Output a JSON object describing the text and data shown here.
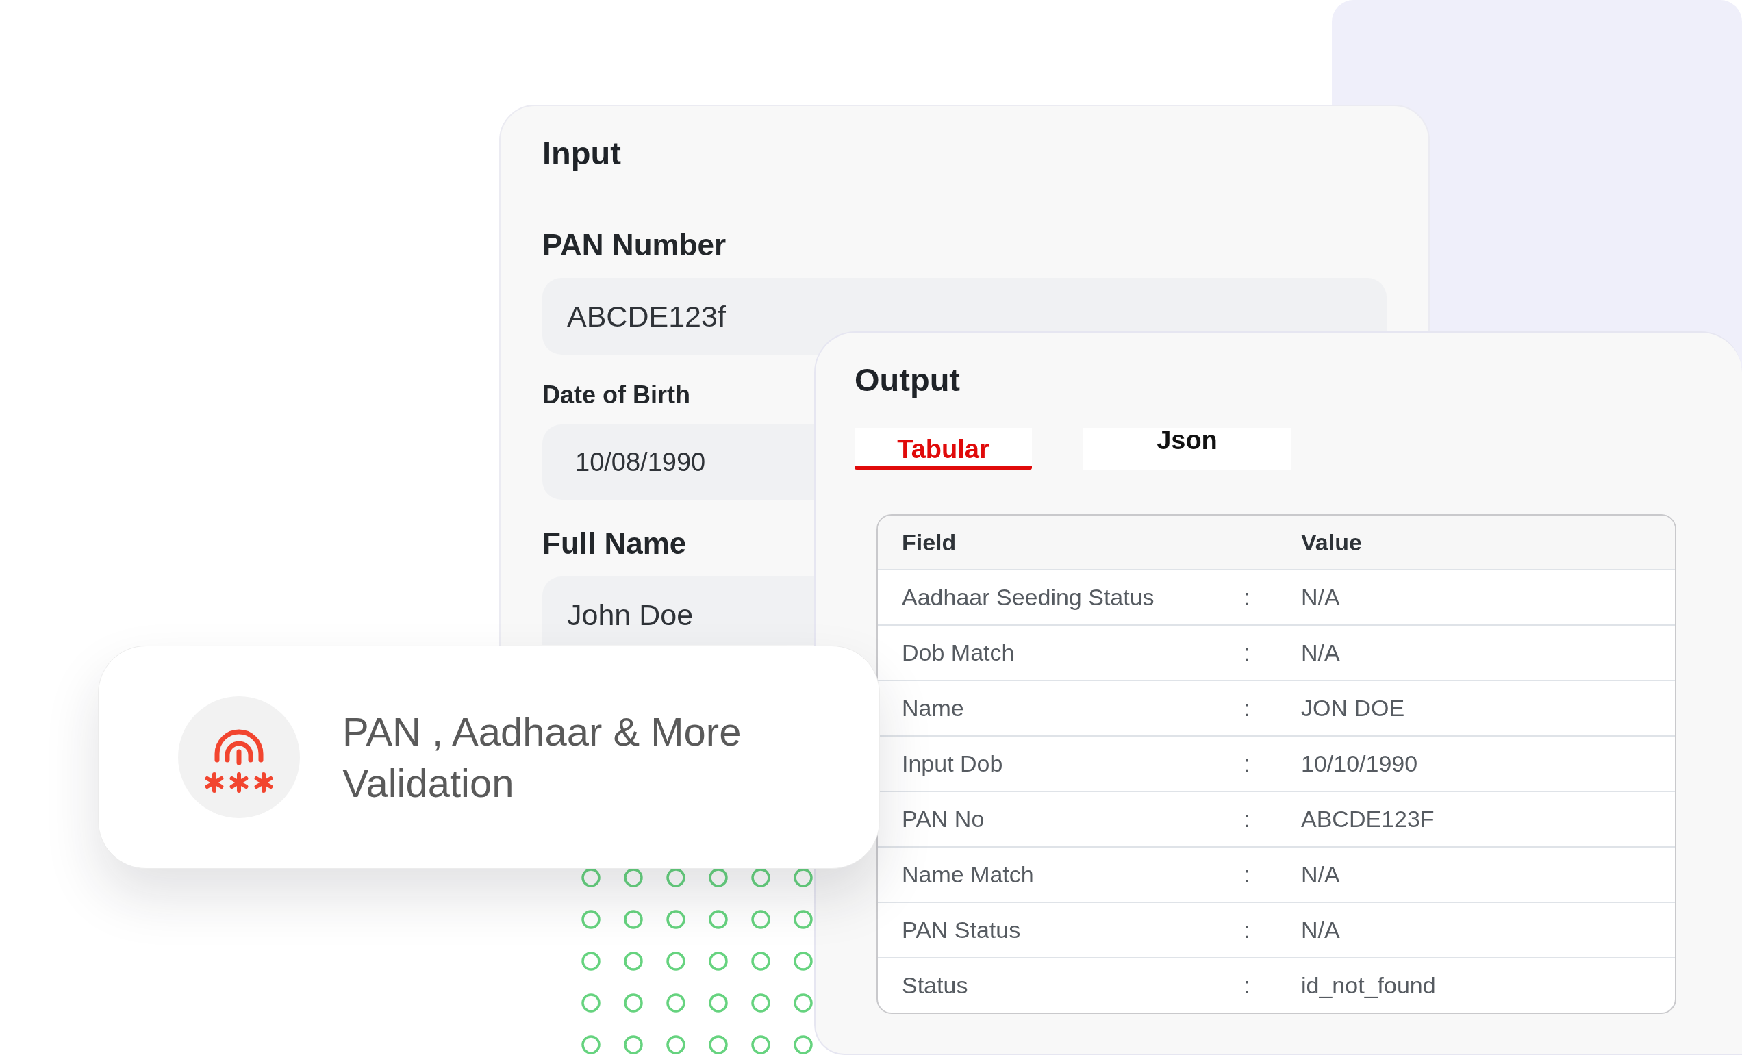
{
  "input_panel": {
    "title": "Input",
    "fields": [
      {
        "kind": "standard",
        "label": "PAN Number",
        "value": "ABCDE123f"
      },
      {
        "kind": "compact",
        "label": "Date of Birth",
        "value": "10/08/1990"
      },
      {
        "kind": "standard",
        "label": "Full Name",
        "value": "John Doe"
      }
    ]
  },
  "output_panel": {
    "title": "Output",
    "tabs": [
      {
        "label": "Tabular",
        "selected": true
      },
      {
        "label": "Json",
        "selected": false
      }
    ],
    "table": {
      "columns": [
        "Field",
        "Value"
      ],
      "rows": [
        {
          "field": "Aadhaar Seeding Status",
          "separator": ":",
          "value": "N/A"
        },
        {
          "field": "Dob Match",
          "separator": ":",
          "value": "N/A"
        },
        {
          "field": "Name",
          "separator": ":",
          "value": "JON DOE"
        },
        {
          "field": "Input Dob",
          "separator": ":",
          "value": "10/10/1990"
        },
        {
          "field": "PAN No",
          "separator": ":",
          "value": "ABCDE123F"
        },
        {
          "field": "Name Match",
          "separator": ":",
          "value": "N/A"
        },
        {
          "field": "PAN Status",
          "separator": ":",
          "value": "N/A"
        },
        {
          "field": "Status",
          "separator": ":",
          "value": "id_not_found"
        }
      ]
    }
  },
  "feature_card": {
    "text": "PAN , Aadhaar & More Validation"
  }
}
